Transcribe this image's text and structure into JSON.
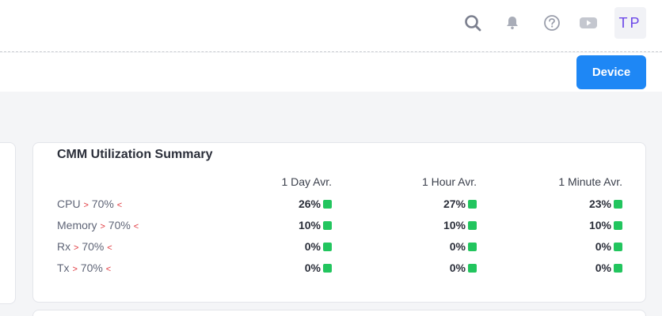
{
  "header": {
    "icons": [
      "search-icon",
      "bell-icon",
      "help-icon",
      "video-icon"
    ],
    "avatar_initials": "TP"
  },
  "toolbar": {
    "device_label": "Device"
  },
  "summary": {
    "title": "CMM Utilization Summary",
    "columns": [
      "1 Day Avr.",
      "1 Hour Avr.",
      "1 Minute Avr."
    ],
    "status_color": "#22c55e",
    "threshold_color": "#e0343a",
    "rows": [
      {
        "label": "CPU",
        "gt": ">",
        "threshold": "70%",
        "lt": "<",
        "values": [
          "26%",
          "27%",
          "23%"
        ]
      },
      {
        "label": "Memory",
        "gt": ">",
        "threshold": "70%",
        "lt": "<",
        "values": [
          "10%",
          "10%",
          "10%"
        ]
      },
      {
        "label": "Rx",
        "gt": ">",
        "threshold": "70%",
        "lt": "<",
        "values": [
          "0%",
          "0%",
          "0%"
        ]
      },
      {
        "label": "Tx",
        "gt": ">",
        "threshold": "70%",
        "lt": "<",
        "values": [
          "0%",
          "0%",
          "0%"
        ]
      }
    ]
  }
}
